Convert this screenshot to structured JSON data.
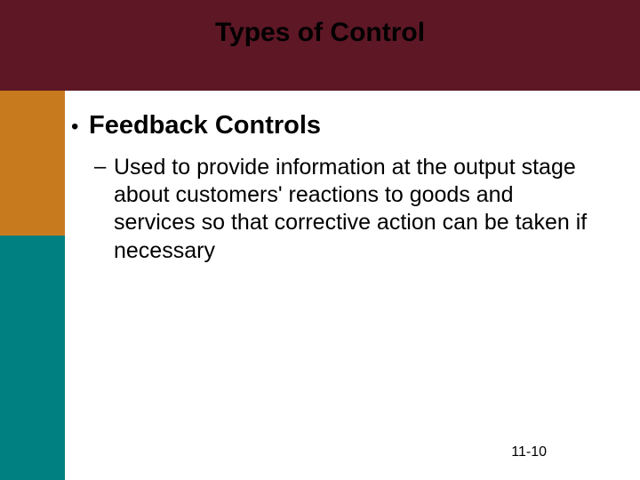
{
  "title": "Types of Control",
  "bullet": {
    "symbol": "•",
    "label": "Feedback Controls"
  },
  "sub": {
    "dash": "–",
    "text": "Used to provide information at the output stage about customers' reactions to goods and services so that corrective action can be taken if necessary"
  },
  "footer": "11-10"
}
